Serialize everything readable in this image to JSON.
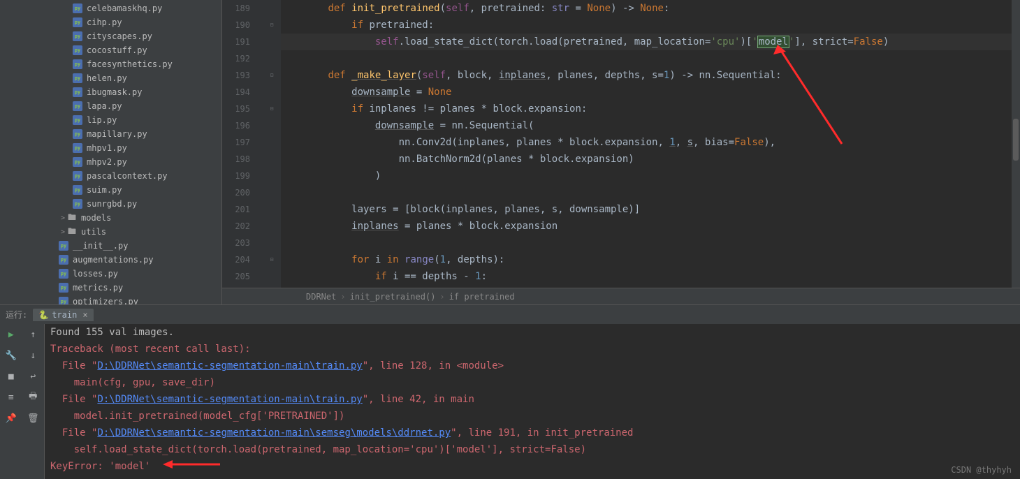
{
  "sidebar": {
    "files": [
      {
        "name": "celebamaskhq.py",
        "type": "py",
        "indent": 1
      },
      {
        "name": "cihp.py",
        "type": "py",
        "indent": 1
      },
      {
        "name": "cityscapes.py",
        "type": "py",
        "indent": 1
      },
      {
        "name": "cocostuff.py",
        "type": "py",
        "indent": 1
      },
      {
        "name": "facesynthetics.py",
        "type": "py",
        "indent": 1
      },
      {
        "name": "helen.py",
        "type": "py",
        "indent": 1
      },
      {
        "name": "ibugmask.py",
        "type": "py",
        "indent": 1
      },
      {
        "name": "lapa.py",
        "type": "py",
        "indent": 1
      },
      {
        "name": "lip.py",
        "type": "py",
        "indent": 1
      },
      {
        "name": "mapillary.py",
        "type": "py",
        "indent": 1
      },
      {
        "name": "mhpv1.py",
        "type": "py",
        "indent": 1
      },
      {
        "name": "mhpv2.py",
        "type": "py",
        "indent": 1
      },
      {
        "name": "pascalcontext.py",
        "type": "py",
        "indent": 1
      },
      {
        "name": "suim.py",
        "type": "py",
        "indent": 1
      },
      {
        "name": "sunrgbd.py",
        "type": "py",
        "indent": 1
      },
      {
        "name": "models",
        "type": "folder",
        "indent": 0
      },
      {
        "name": "utils",
        "type": "folder",
        "indent": 0
      },
      {
        "name": "__init__.py",
        "type": "py",
        "indent": 0
      },
      {
        "name": "augmentations.py",
        "type": "py",
        "indent": 0
      },
      {
        "name": "losses.py",
        "type": "py",
        "indent": 0
      },
      {
        "name": "metrics.py",
        "type": "py",
        "indent": 0
      },
      {
        "name": "optimizers.py",
        "type": "py",
        "indent": 0
      }
    ]
  },
  "editor": {
    "startLine": 189,
    "lines": [
      {
        "n": 189,
        "fold": "",
        "html": "        <span class='kw'>def</span> <span class='def'>init_pretrained</span>(<span class='self'>self</span>, pretrained: <span class='type'>str</span> = <span class='const'>None</span>) -> <span class='const'>None</span>:"
      },
      {
        "n": 190,
        "fold": "⊟",
        "html": "            <span class='kw'>if</span> pretrained:"
      },
      {
        "n": 191,
        "fold": "",
        "hl": true,
        "html": "                <span class='self'>self</span>.load_state_dict(torch.load(pretrained, map_location=<span class='str'>'cpu'</span>)[<span class='str'>'</span><span class='highlight-box'>model</span><span class='str'>'</span>], strict=<span class='const'>False</span>)"
      },
      {
        "n": 192,
        "fold": "",
        "html": ""
      },
      {
        "n": 193,
        "fold": "⊟",
        "html": "        <span class='kw'>def</span> <span class='def underline'>_make_layer</span>(<span class='self'>self</span>, block, <span class='underline'>inplanes</span>, planes, depths, s=<span class='num'>1</span>) -> nn.Sequential:"
      },
      {
        "n": 194,
        "fold": "",
        "html": "            <span class='underline'>downsample</span> = <span class='const'>None</span>"
      },
      {
        "n": 195,
        "fold": "⊟",
        "html": "            <span class='kw'>if</span> inplanes != planes * block.expansion:"
      },
      {
        "n": 196,
        "fold": "",
        "html": "                <span class='underline'>downsample</span> = nn.Sequential("
      },
      {
        "n": 197,
        "fold": "",
        "html": "                    nn.Conv2d(inplanes, planes * block.expansion, <span class='num underline'>1</span>, <span class='underline'>s</span>, bias=<span class='const'>False</span>),"
      },
      {
        "n": 198,
        "fold": "",
        "html": "                    nn.BatchNorm2d(planes * block.expansion)"
      },
      {
        "n": 199,
        "fold": "",
        "html": "                )"
      },
      {
        "n": 200,
        "fold": "",
        "html": ""
      },
      {
        "n": 201,
        "fold": "",
        "html": "            layers = [block(inplanes, planes, s, downsample)]"
      },
      {
        "n": 202,
        "fold": "",
        "html": "            <span class='underline'>inplanes</span> = planes * block.expansion"
      },
      {
        "n": 203,
        "fold": "",
        "html": ""
      },
      {
        "n": 204,
        "fold": "⊟",
        "html": "            <span class='kw'>for</span> i <span class='kw'>in</span> <span class='type'>range</span>(<span class='num'>1</span>, depths):"
      },
      {
        "n": 205,
        "fold": "",
        "html": "                <span class='kw'>if</span> i == depths - <span class='num'>1</span>:"
      }
    ]
  },
  "breadcrumb": {
    "items": [
      "DDRNet",
      "init_pretrained()",
      "if pretrained"
    ]
  },
  "run": {
    "label": "运行:",
    "tab": "train"
  },
  "console": {
    "lines": [
      {
        "cls": "plain",
        "text": "Found 155 val images."
      },
      {
        "cls": "err",
        "text": "Traceback (most recent call last):"
      },
      {
        "cls": "mix",
        "parts": [
          {
            "cls": "err",
            "text": "  File \""
          },
          {
            "cls": "link",
            "text": "D:\\DDRNet\\semantic-segmentation-main\\train.py"
          },
          {
            "cls": "err",
            "text": "\", line 128, in <module>"
          }
        ]
      },
      {
        "cls": "err",
        "text": "    main(cfg, gpu, save_dir)"
      },
      {
        "cls": "mix",
        "parts": [
          {
            "cls": "err",
            "text": "  File \""
          },
          {
            "cls": "link",
            "text": "D:\\DDRNet\\semantic-segmentation-main\\train.py"
          },
          {
            "cls": "err",
            "text": "\", line 42, in main"
          }
        ]
      },
      {
        "cls": "err",
        "text": "    model.init_pretrained(model_cfg['PRETRAINED'])"
      },
      {
        "cls": "mix",
        "parts": [
          {
            "cls": "err",
            "text": "  File \""
          },
          {
            "cls": "link",
            "text": "D:\\DDRNet\\semantic-segmentation-main\\semseg\\models\\ddrnet.py"
          },
          {
            "cls": "err",
            "text": "\", line 191, in init_pretrained"
          }
        ]
      },
      {
        "cls": "err",
        "text": "    self.load_state_dict(torch.load(pretrained, map_location='cpu')['model'], strict=False)"
      },
      {
        "cls": "err",
        "text": "KeyError: 'model'"
      }
    ]
  },
  "watermark": "CSDN @thyhyh"
}
